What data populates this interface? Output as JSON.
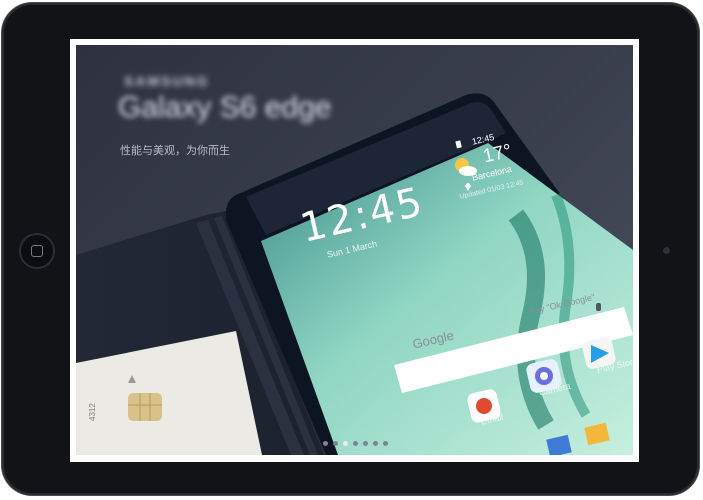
{
  "slide": {
    "brand_text": "SAMSUNG",
    "product_text": "Galaxy S6 edge",
    "tagline": "性能与美观，为你而生"
  },
  "phone_screen": {
    "status_time": "12:45",
    "clock": "12:45",
    "date": "Sun 1 March",
    "temperature": "17°",
    "city": "Barcelona",
    "updated": "Updated 01/03 12:45",
    "search_logo": "Google",
    "search_hint": "Say \"Ok Google\"",
    "apps": [
      {
        "label": "Email",
        "icon": "email-icon"
      },
      {
        "label": "Camera",
        "icon": "camera-icon"
      },
      {
        "label": "Play Store",
        "icon": "play-store-icon"
      }
    ]
  },
  "card": {
    "number": "4312"
  },
  "carousel": {
    "count": 7,
    "active_index": 2
  },
  "colors": {
    "tablet_bezel": "#121317",
    "slide_background": "#353a48",
    "phone_screen_green": "#7ccfb8"
  }
}
